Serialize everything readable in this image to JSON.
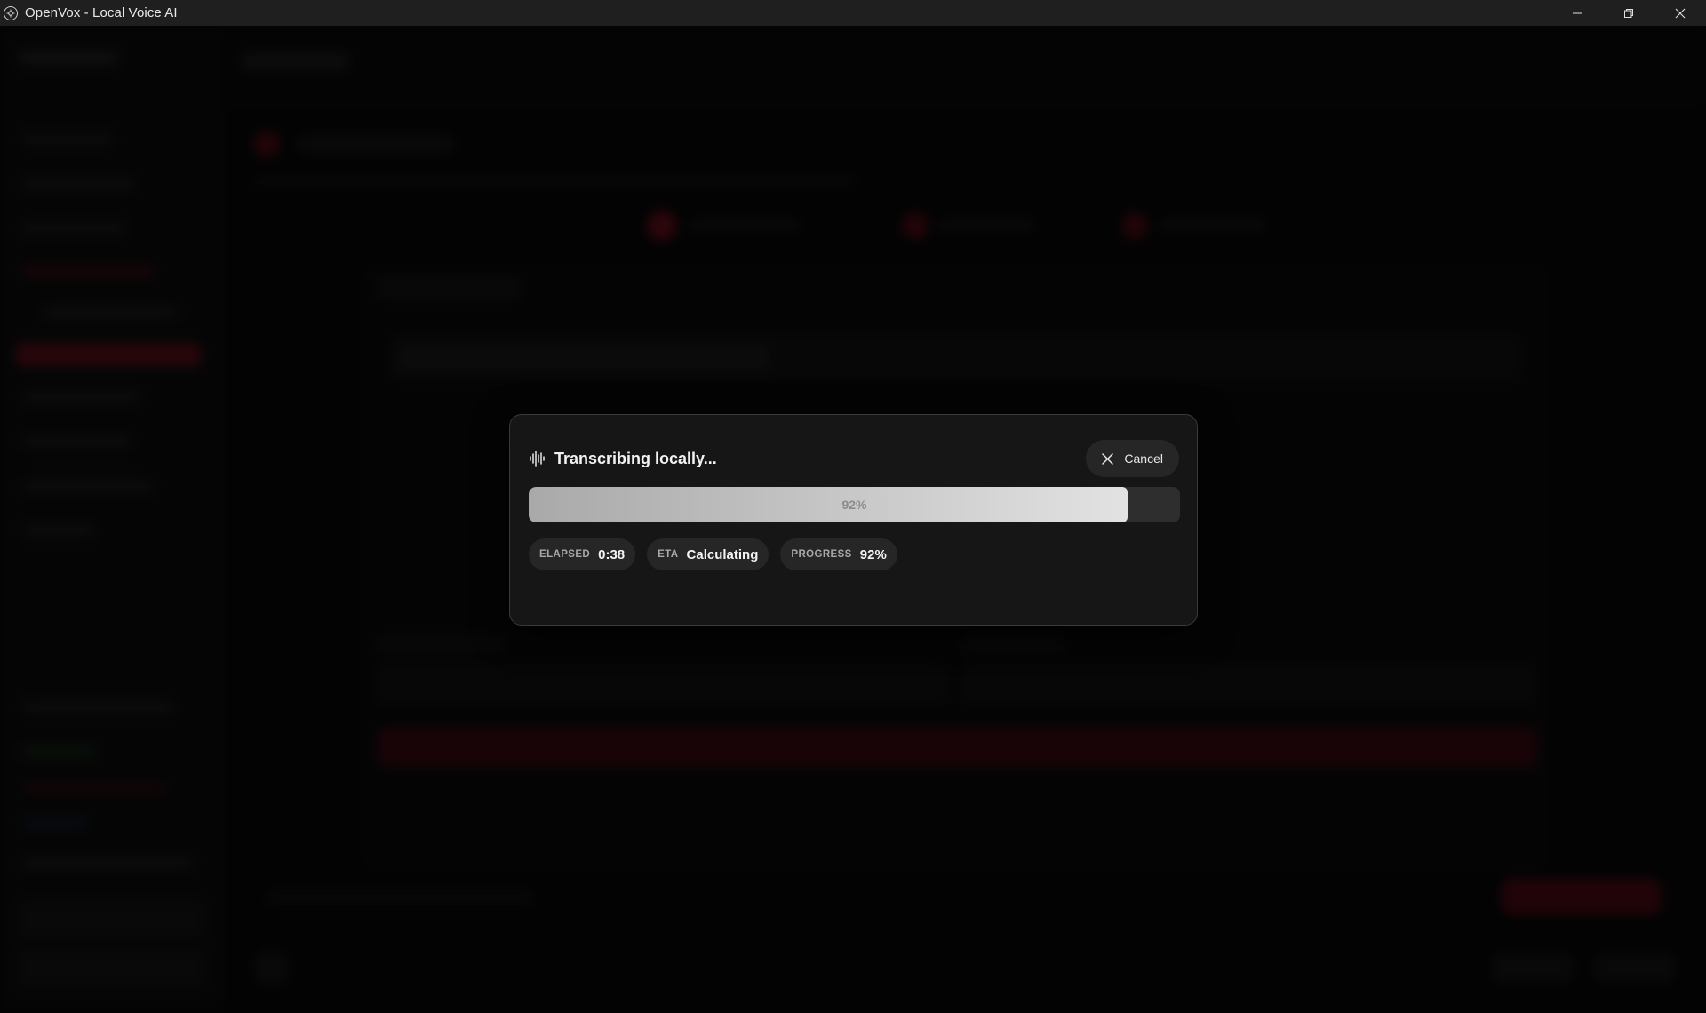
{
  "window": {
    "title": "OpenVox - Local Voice AI",
    "controls": [
      "minimize-icon",
      "restore-icon",
      "close-icon"
    ]
  },
  "dialog": {
    "title": "Transcribing locally...",
    "icon": "audio-waveform-icon",
    "cancel_label": "Cancel",
    "progress": {
      "fraction": 0.92,
      "label": "92%"
    },
    "stats": [
      {
        "key": "ELAPSED",
        "value": "0:38"
      },
      {
        "key": "ETA",
        "value": "Calculating"
      },
      {
        "key": "PROGRESS",
        "value": "92%"
      }
    ]
  },
  "colors": {
    "accent": "#7a1020",
    "modal_bg": "#161616",
    "chip_bg": "#262626"
  }
}
